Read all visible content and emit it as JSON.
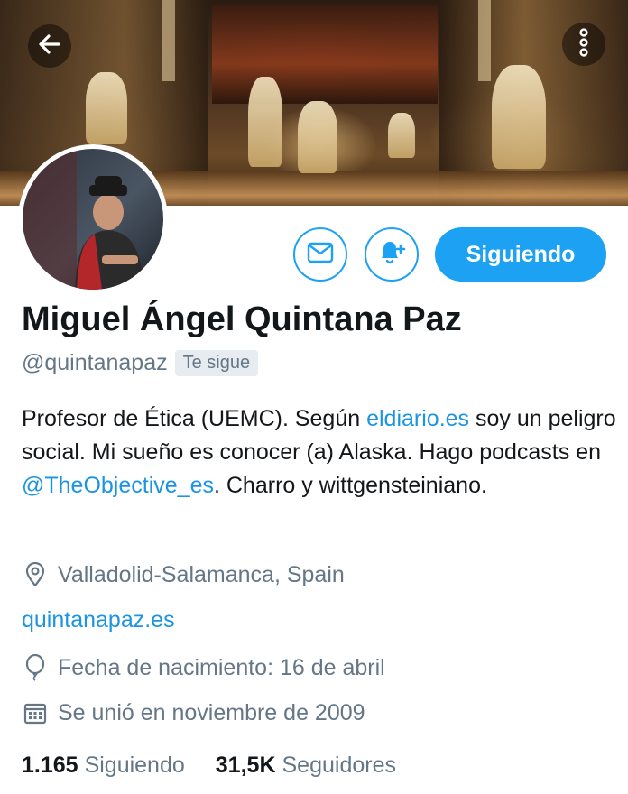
{
  "header": {
    "back_icon": "arrow-left-icon",
    "more_icon": "vertical-dots-icon"
  },
  "actions": {
    "message_icon": "envelope-icon",
    "notify_icon": "bell-plus-icon",
    "follow_label": "Siguiendo"
  },
  "profile": {
    "name": "Miguel Ángel Quintana Paz",
    "handle": "@quintanapaz",
    "follows_you": "Te sigue",
    "bio": {
      "part1": "Profesor de Ética (UEMC). Según ",
      "link1": "eldiario.es",
      "part2": " soy un peligro social. Mi sueño es conocer (a) Alaska. Hago podcasts en ",
      "link2": "@TheObjective_es",
      "part3": ". Charro y wittgensteiniano."
    },
    "location": "Valladolid-Salamanca, Spain",
    "website": "quintanapaz.es",
    "birthday": "Fecha de nacimiento: 16 de abril",
    "joined": "Se unió en noviembre de 2009"
  },
  "stats": {
    "following_count": "1.165",
    "following_label": "Siguiendo",
    "followers_count": "31,5K",
    "followers_label": "Seguidores"
  },
  "colors": {
    "accent": "#1da1f2",
    "link": "#1b95e0",
    "secondary_text": "#657786"
  }
}
